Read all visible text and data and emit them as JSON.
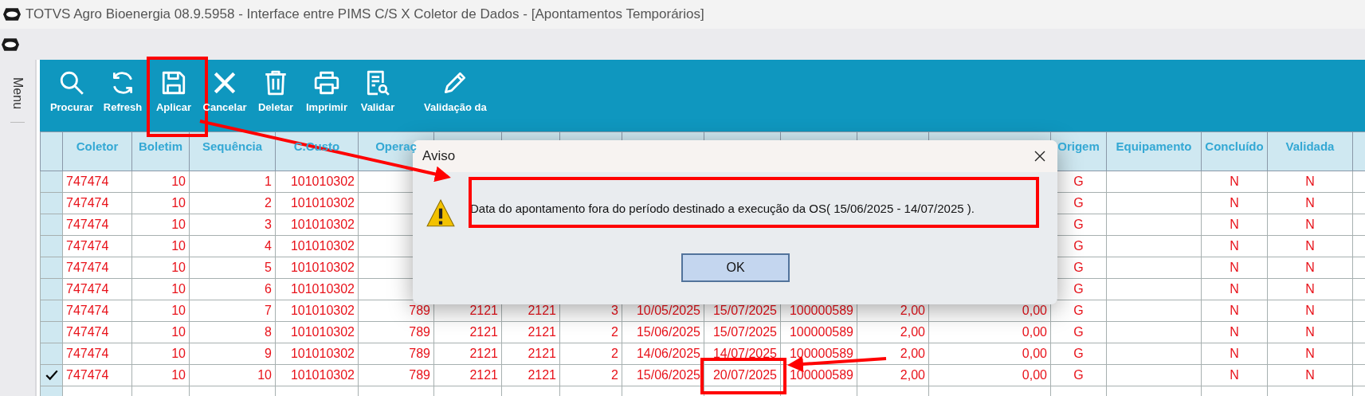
{
  "window": {
    "title": "TOTVS Agro Bioenergia 08.9.5958 - Interface entre PIMS C/S X Coletor de Dados - [Apontamentos Temporários]"
  },
  "sidebar": {
    "label": "Menu"
  },
  "toolbar": [
    {
      "label": "Procurar"
    },
    {
      "label": "Refresh"
    },
    {
      "label": "Aplicar"
    },
    {
      "label": "Cancelar"
    },
    {
      "label": "Deletar"
    },
    {
      "label": "Imprimir"
    },
    {
      "label": "Validar"
    },
    {
      "label": "Validação da"
    }
  ],
  "table": {
    "columns": [
      "Coletor",
      "Boletim",
      "Sequência",
      "C.Custo",
      "Operaç",
      null,
      null,
      null,
      null,
      null,
      null,
      null,
      null,
      "Origem",
      "Equipamento",
      "Concluído",
      "Validada",
      null
    ],
    "rows": [
      {
        "marked": false,
        "cells": [
          "747474",
          "10",
          "1",
          "101010302",
          null,
          null,
          null,
          null,
          null,
          null,
          null,
          null,
          null,
          "G",
          null,
          "N",
          "N",
          null
        ]
      },
      {
        "marked": false,
        "cells": [
          "747474",
          "10",
          "2",
          "101010302",
          null,
          null,
          null,
          null,
          null,
          null,
          null,
          null,
          null,
          "G",
          null,
          "N",
          "N",
          null
        ]
      },
      {
        "marked": false,
        "cells": [
          "747474",
          "10",
          "3",
          "101010302",
          null,
          null,
          null,
          null,
          null,
          null,
          null,
          null,
          null,
          "G",
          null,
          "N",
          "N",
          null
        ]
      },
      {
        "marked": false,
        "cells": [
          "747474",
          "10",
          "4",
          "101010302",
          null,
          null,
          null,
          null,
          null,
          null,
          null,
          null,
          null,
          "G",
          null,
          "N",
          "N",
          null
        ]
      },
      {
        "marked": false,
        "cells": [
          "747474",
          "10",
          "5",
          "101010302",
          null,
          null,
          null,
          null,
          null,
          null,
          null,
          null,
          null,
          "G",
          null,
          "N",
          "N",
          null
        ]
      },
      {
        "marked": false,
        "cells": [
          "747474",
          "10",
          "6",
          "101010302",
          null,
          null,
          null,
          null,
          null,
          null,
          null,
          null,
          null,
          "G",
          null,
          "N",
          "N",
          null
        ]
      },
      {
        "marked": false,
        "cells": [
          "747474",
          "10",
          "7",
          "101010302",
          "789",
          "2121",
          "2121",
          "3",
          "10/05/2025",
          "15/07/2025",
          "100000589",
          "2,00",
          "0,00",
          "G",
          null,
          "N",
          "N",
          null
        ]
      },
      {
        "marked": false,
        "cells": [
          "747474",
          "10",
          "8",
          "101010302",
          "789",
          "2121",
          "2121",
          "2",
          "15/06/2025",
          "15/07/2025",
          "100000589",
          "2,00",
          "0,00",
          "G",
          null,
          "N",
          "N",
          null
        ]
      },
      {
        "marked": false,
        "cells": [
          "747474",
          "10",
          "9",
          "101010302",
          "789",
          "2121",
          "2121",
          "2",
          "14/06/2025",
          "14/07/2025",
          "100000589",
          "2,00",
          "0,00",
          "G",
          null,
          "N",
          "N",
          null
        ]
      },
      {
        "marked": true,
        "cells": [
          "747474",
          "10",
          "10",
          "101010302",
          "789",
          "2121",
          "2121",
          "2",
          "15/06/2025",
          "20/07/2025",
          "100000589",
          "2,00",
          "0,00",
          "G",
          null,
          "N",
          "N",
          null
        ]
      }
    ]
  },
  "dialog": {
    "title": "Aviso",
    "message": "Data do apontamento fora do período destinado a execução da OS( 15/06/2025 - 14/07/2025 ).",
    "button": "OK"
  }
}
